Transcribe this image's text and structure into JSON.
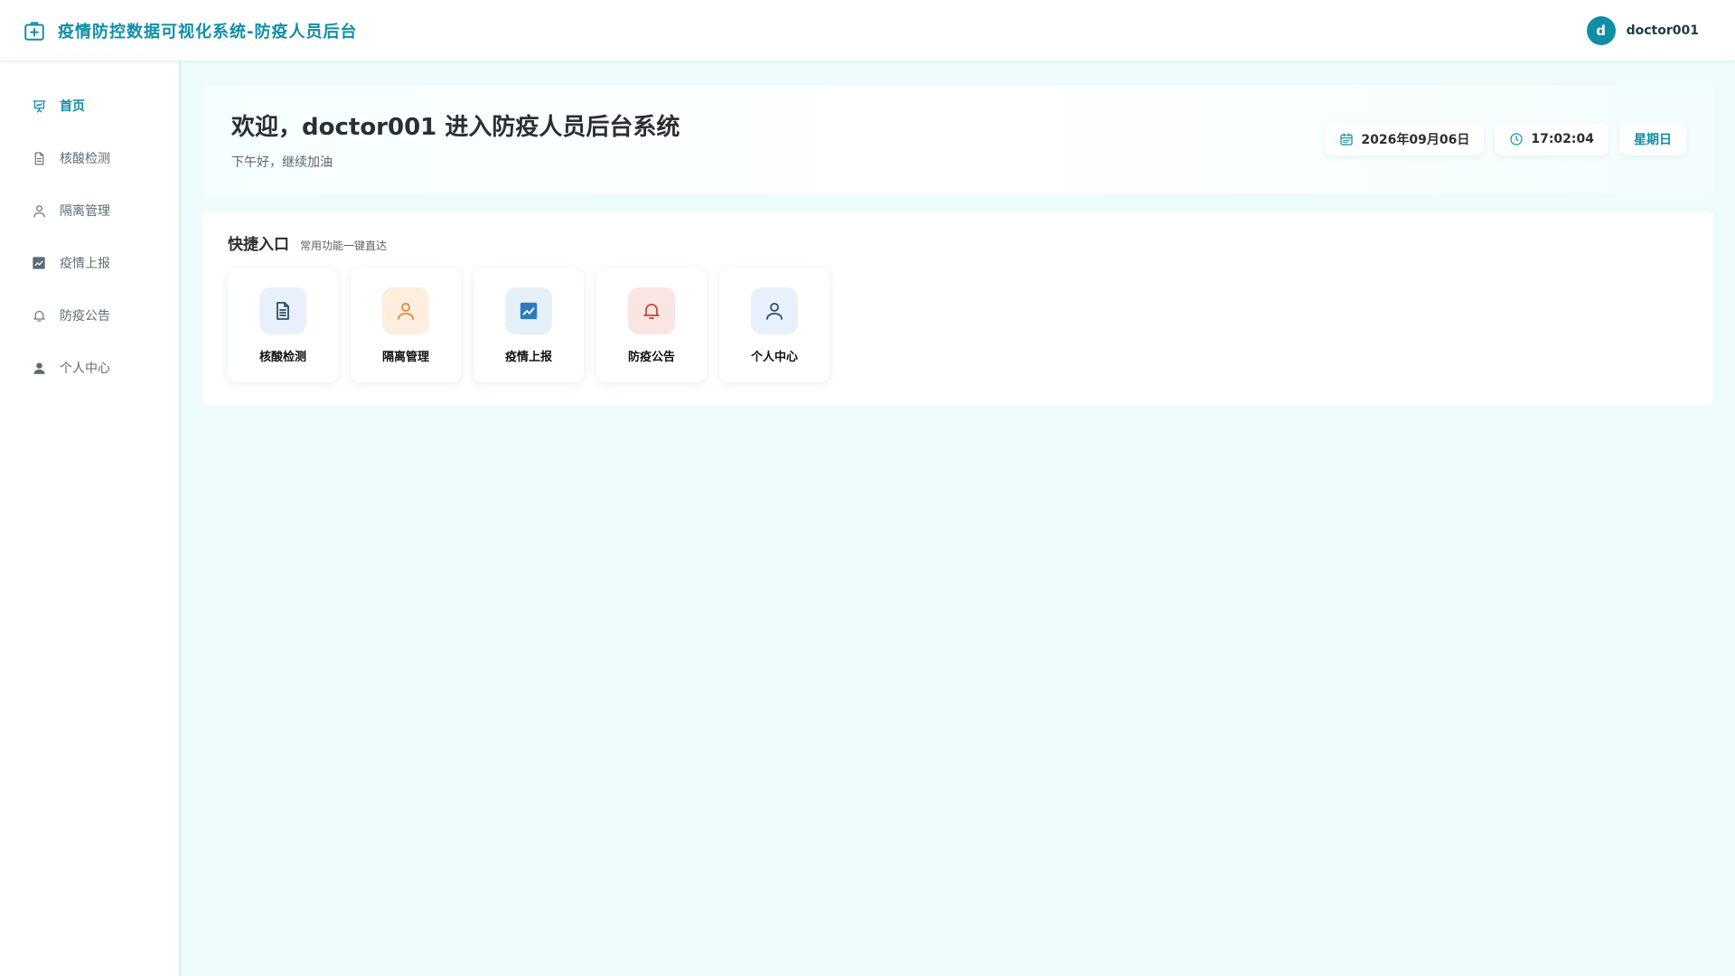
{
  "header": {
    "title": "疫情防控数据可视化系统-防疫人员后台",
    "brand_icon": "medical-box-icon",
    "user": {
      "avatar_letter": "d",
      "name": "doctor001"
    }
  },
  "sidebar": {
    "items": [
      {
        "label": "首页",
        "icon": "presentation-chart-icon",
        "active": true
      },
      {
        "label": "核酸检测",
        "icon": "document-icon",
        "active": false
      },
      {
        "label": "隔离管理",
        "icon": "user-icon",
        "active": false
      },
      {
        "label": "疫情上报",
        "icon": "trend-chart-icon",
        "active": false
      },
      {
        "label": "防疫公告",
        "icon": "bell-icon",
        "active": false
      },
      {
        "label": "个人中心",
        "icon": "user-filled-icon",
        "active": false
      }
    ]
  },
  "welcome": {
    "title": "欢迎，doctor001 进入防疫人员后台系统",
    "subtitle": "下午好，继续加油",
    "date": "2026年09月06日",
    "time": "17:02:04",
    "weekday": "星期日"
  },
  "quick": {
    "title": "快捷入口",
    "subtitle": "常用功能一键直达",
    "cards": [
      {
        "label": "核酸检测",
        "icon": "document-icon",
        "bg": "#e8f1fb",
        "color": "#2f4d6b"
      },
      {
        "label": "隔离管理",
        "icon": "user-icon",
        "bg": "#fdeedd",
        "color": "#e08a3a"
      },
      {
        "label": "疫情上报",
        "icon": "trend-chart-icon",
        "bg": "#e6f0f8",
        "color": "#2b7bbf"
      },
      {
        "label": "防疫公告",
        "icon": "bell-icon",
        "bg": "#fbe5e3",
        "color": "#c8463b"
      },
      {
        "label": "个人中心",
        "icon": "user-icon",
        "bg": "#e8f1fb",
        "color": "#2f4d6b"
      }
    ]
  },
  "colors": {
    "accent": "#0f8ea6",
    "background": "#eefcfd"
  }
}
